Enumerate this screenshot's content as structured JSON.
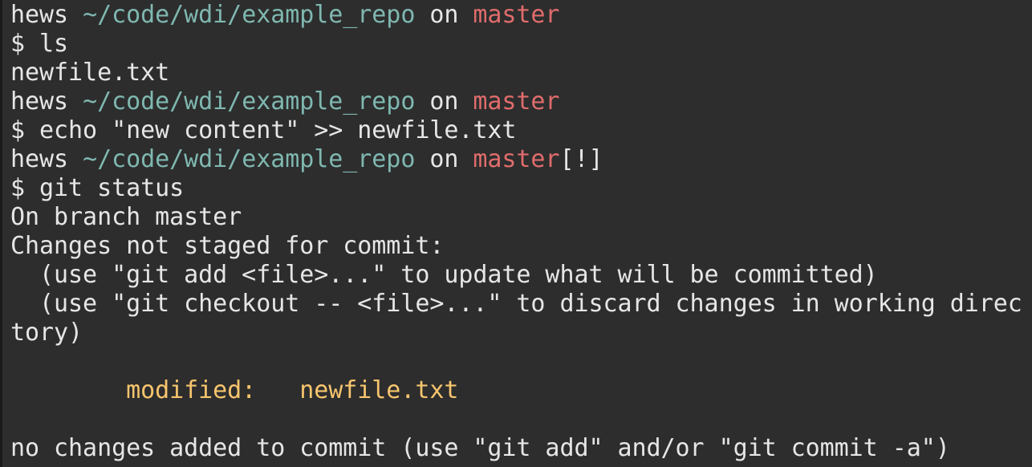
{
  "colors": {
    "background": "#2d2d2d",
    "text": "#e6e6e6",
    "path": "#7fb8b0",
    "branch": "#e06c6c",
    "modified": "#f7c56e"
  },
  "terminal": {
    "lines": [
      [
        {
          "text": "hews ",
          "color": "text"
        },
        {
          "text": "~/code/wdi/example_repo",
          "color": "path"
        },
        {
          "text": " on ",
          "color": "text"
        },
        {
          "text": "master",
          "color": "branch"
        }
      ],
      [
        {
          "text": "$ ls",
          "color": "text"
        }
      ],
      [
        {
          "text": "newfile.txt",
          "color": "text"
        }
      ],
      [
        {
          "text": "hews ",
          "color": "text"
        },
        {
          "text": "~/code/wdi/example_repo",
          "color": "path"
        },
        {
          "text": " on ",
          "color": "text"
        },
        {
          "text": "master",
          "color": "branch"
        }
      ],
      [
        {
          "text": "$ echo \"new content\" >> newfile.txt",
          "color": "text"
        }
      ],
      [
        {
          "text": "hews ",
          "color": "text"
        },
        {
          "text": "~/code/wdi/example_repo",
          "color": "path"
        },
        {
          "text": " on ",
          "color": "text"
        },
        {
          "text": "master",
          "color": "branch"
        },
        {
          "text": "[!]",
          "color": "text"
        }
      ],
      [
        {
          "text": "$ git status",
          "color": "text"
        }
      ],
      [
        {
          "text": "On branch master",
          "color": "text"
        }
      ],
      [
        {
          "text": "Changes not staged for commit:",
          "color": "text"
        }
      ],
      [
        {
          "text": "  (use \"git add <file>...\" to update what will be committed)",
          "color": "text"
        }
      ],
      [
        {
          "text": "  (use \"git checkout -- <file>...\" to discard changes in working direc",
          "color": "text"
        }
      ],
      [
        {
          "text": "tory)",
          "color": "text"
        }
      ],
      [],
      [
        {
          "text": "        modified:   newfile.txt",
          "color": "modified"
        }
      ],
      [],
      [
        {
          "text": "no changes added to commit (use \"git add\" and/or \"git commit -a\")",
          "color": "text"
        }
      ]
    ]
  }
}
